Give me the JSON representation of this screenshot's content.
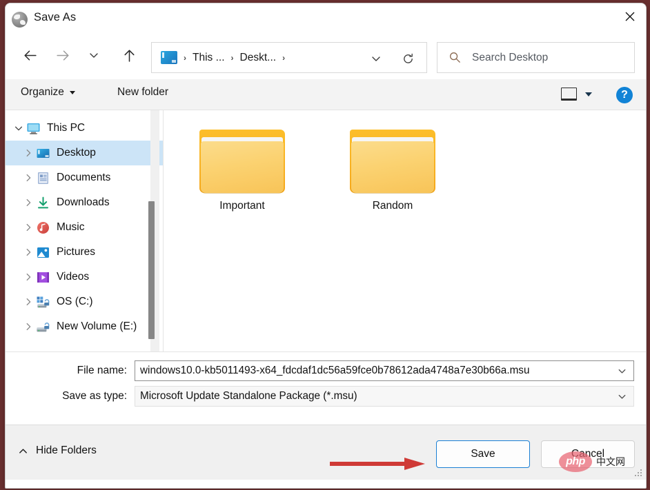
{
  "window": {
    "title": "Save As",
    "title_icon": "globe-icon",
    "close_label": "×"
  },
  "nav": {
    "back_icon": "arrow-left-icon",
    "forward_icon": "arrow-right-icon",
    "recent_icon": "chevron-down-icon",
    "up_icon": "arrow-up-icon",
    "breadcrumb": {
      "root_icon": "this-pc-icon",
      "items": [
        "This ...",
        "Deskt..."
      ],
      "separator": "›",
      "dropdown_icon": "chevron-down-icon",
      "refresh_icon": "refresh-icon"
    },
    "search": {
      "icon": "search-icon",
      "placeholder": "Search Desktop",
      "value": ""
    }
  },
  "toolbar": {
    "organize_label": "Organize",
    "organize_caret_icon": "caret-down-icon",
    "new_folder_label": "New folder",
    "view_icon": "view-layout-icon",
    "view_caret_icon": "caret-down-icon",
    "help_label": "?",
    "help_icon": "help-icon",
    "help_color": "#1183d6"
  },
  "sidebar": {
    "items": [
      {
        "label": "This PC",
        "icon": "monitor-icon",
        "chevron": "chevron-down-icon",
        "indent": false,
        "selected": false
      },
      {
        "label": "Desktop",
        "icon": "desktop-icon",
        "chevron": "chevron-right-icon",
        "indent": true,
        "selected": true
      },
      {
        "label": "Documents",
        "icon": "documents-icon",
        "chevron": "chevron-right-icon",
        "indent": true,
        "selected": false
      },
      {
        "label": "Downloads",
        "icon": "downloads-icon",
        "chevron": "chevron-right-icon",
        "indent": true,
        "selected": false
      },
      {
        "label": "Music",
        "icon": "music-icon",
        "chevron": "chevron-right-icon",
        "indent": true,
        "selected": false
      },
      {
        "label": "Pictures",
        "icon": "pictures-icon",
        "chevron": "chevron-right-icon",
        "indent": true,
        "selected": false
      },
      {
        "label": "Videos",
        "icon": "videos-icon",
        "chevron": "chevron-right-icon",
        "indent": true,
        "selected": false
      },
      {
        "label": "OS (C:)",
        "icon": "os-drive-icon",
        "chevron": "chevron-right-icon",
        "indent": true,
        "selected": false
      },
      {
        "label": "New Volume (E:)",
        "icon": "drive-icon",
        "chevron": "chevron-right-icon",
        "indent": true,
        "selected": false
      }
    ],
    "selection_color": "#cce4f7",
    "scrollbar": "vertical-scrollbar"
  },
  "files": [
    {
      "name": "Important",
      "icon": "folder-icon"
    },
    {
      "name": "Random",
      "icon": "folder-icon"
    }
  ],
  "form": {
    "file_name_label": "File name:",
    "file_name_value": "windows10.0-kb5011493-x64_fdcdaf1dc56a59fce0b78612ada4748a7e30b66a.msu",
    "file_name_caret_icon": "chevron-down-icon",
    "save_type_label": "Save as type:",
    "save_type_value": "Microsoft Update Standalone Package (*.msu)",
    "save_type_caret_icon": "chevron-down-icon"
  },
  "footer": {
    "hide_folders_label": "Hide Folders",
    "hide_folders_icon": "chevron-up-icon",
    "save_label": "Save",
    "cancel_label": "Cancel",
    "save_border_color": "#1a7fd4",
    "grip_icon": "resize-grip-icon"
  },
  "annotation": {
    "arrow_icon": "red-arrow-icon",
    "arrow_color": "#cf3a36"
  },
  "watermark": {
    "badge_text": "php",
    "cn_text": "中文网",
    "badge_color": "#e7606e"
  }
}
